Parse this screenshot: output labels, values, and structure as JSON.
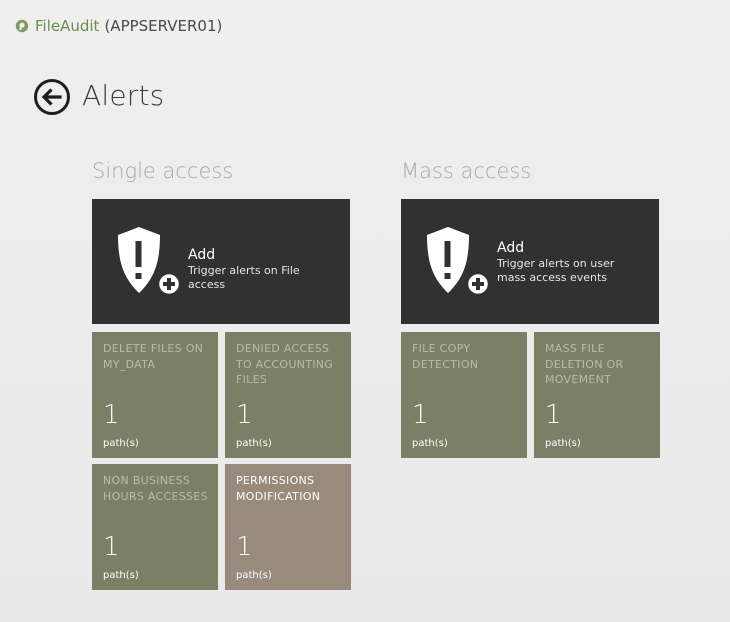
{
  "app": {
    "name": "FileAudit",
    "server": "(APPSERVER01)"
  },
  "header": {
    "title": "Alerts"
  },
  "sections": {
    "single": {
      "title": "Single access",
      "add": {
        "label": "Add",
        "description": "Trigger alerts on File access"
      },
      "tiles": [
        {
          "label": "DELETE FILES ON MY_DATA",
          "count": "1",
          "unit": "path(s)"
        },
        {
          "label": "DENIED ACCESS TO ACCOUNTING FILES",
          "count": "1",
          "unit": "path(s)"
        },
        {
          "label": "NON BUSINESS HOURS ACCESSES",
          "count": "1",
          "unit": "path(s)"
        },
        {
          "label": "PERMISSIONS MODIFICATION",
          "count": "1",
          "unit": "path(s)"
        }
      ]
    },
    "mass": {
      "title": "Mass access",
      "add": {
        "label": "Add",
        "description": "Trigger alerts on user mass access events"
      },
      "tiles": [
        {
          "label": "FILE COPY DETECTION",
          "count": "1",
          "unit": "path(s)"
        },
        {
          "label": "MASS FILE DELETION OR MOVEMENT",
          "count": "1",
          "unit": "path(s)"
        }
      ]
    }
  },
  "colors": {
    "tile_green": "#7a7f66",
    "tile_brown": "#988b7e",
    "add_tile": "#313131",
    "app_accent": "#6b8f4e"
  },
  "icons": {
    "logo": "fileaudit-logo-icon",
    "back": "back-arrow-icon",
    "alert": "shield-alert-add-icon"
  }
}
